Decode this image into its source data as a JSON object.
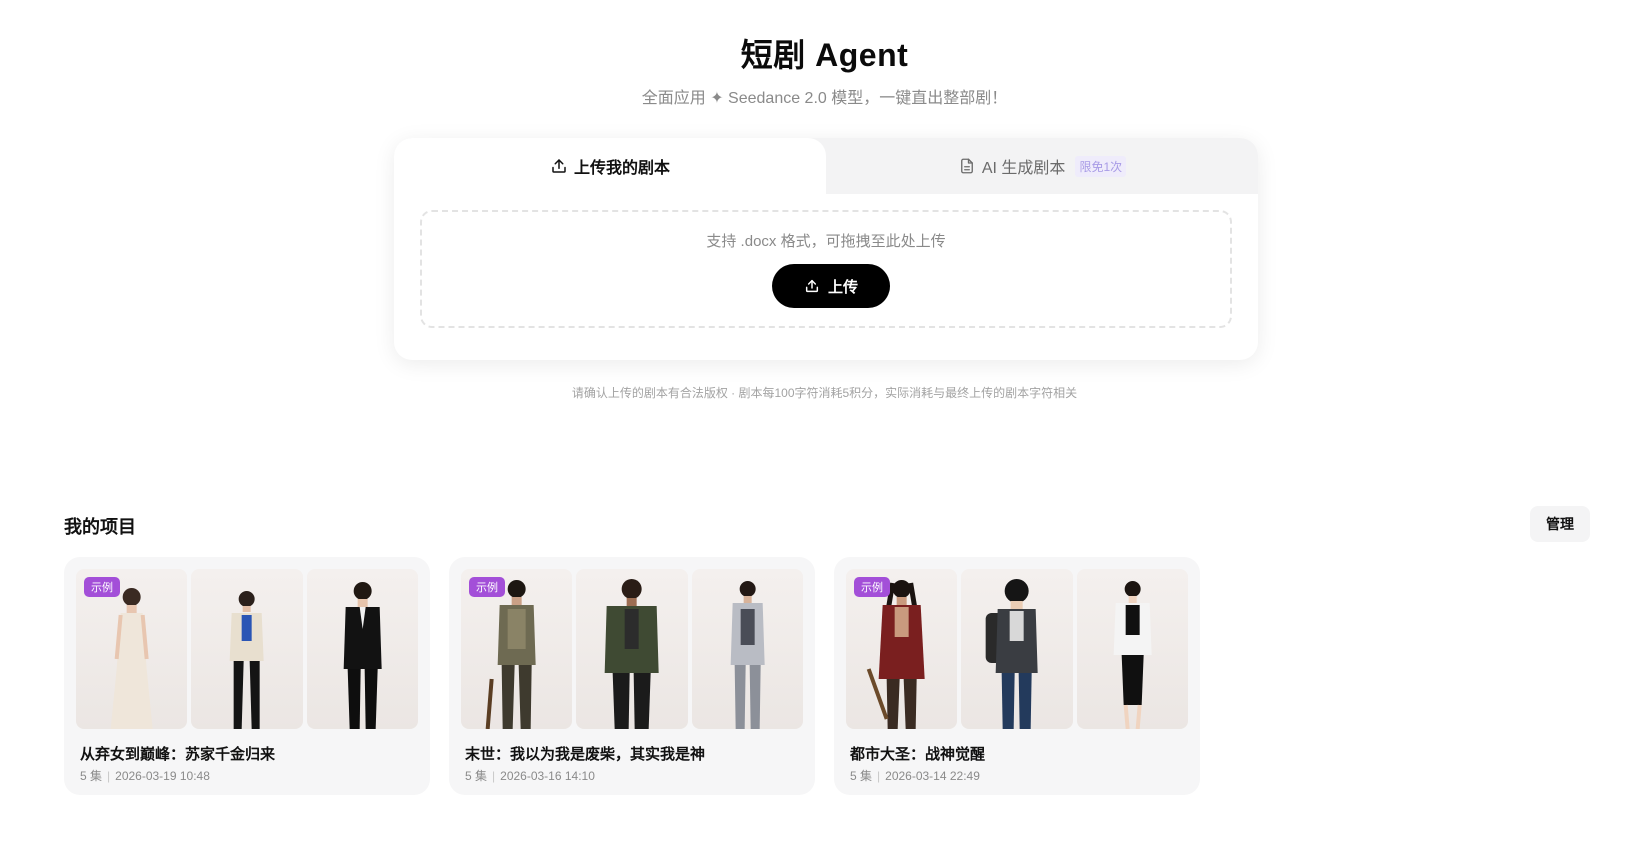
{
  "header": {
    "title": "短剧 Agent",
    "subtitle": "全面应用 ✦ Seedance 2.0 模型，一键直出整部剧！"
  },
  "tabs": [
    {
      "label": "上传我的剧本",
      "icon": "upload-icon",
      "active": true
    },
    {
      "label": "AI 生成剧本",
      "icon": "document-icon",
      "badge": "限免1次",
      "active": false
    }
  ],
  "upload": {
    "hint": "支持 .docx 格式，可拖拽至此处上传",
    "button_label": "上传"
  },
  "disclaimer": "请确认上传的剧本有合法版权 · 剧本每100字符消耗5积分，实际消耗与最终上传的剧本字符相关",
  "projects_section": {
    "title": "我的项目",
    "manage_label": "管理"
  },
  "projects": [
    {
      "badge": "示例",
      "title": "从弃女到巅峰：苏家千金归来",
      "episodes": "5 集",
      "date": "2026-03-19 10:48",
      "characters": [
        "woman-white-gown",
        "woman-tweed-jacket",
        "man-black-tuxedo"
      ]
    },
    {
      "badge": "示例",
      "title": "末世：我以为我是废柴，其实我是神",
      "episodes": "5 集",
      "date": "2026-03-16 14:10",
      "characters": [
        "man-survivor-vest",
        "man-green-jacket",
        "woman-armored-suit"
      ]
    },
    {
      "badge": "示例",
      "title": "都市大圣：战神觉醒",
      "episodes": "5 集",
      "date": "2026-03-14 22:49",
      "characters": [
        "man-red-robe-staff",
        "boy-backpack-hoodie",
        "woman-white-blazer"
      ]
    }
  ],
  "colors": {
    "accent": "#000000",
    "badge": "#a34fd8",
    "free_badge_text": "#a89be6",
    "card_bg": "#f6f6f7"
  }
}
